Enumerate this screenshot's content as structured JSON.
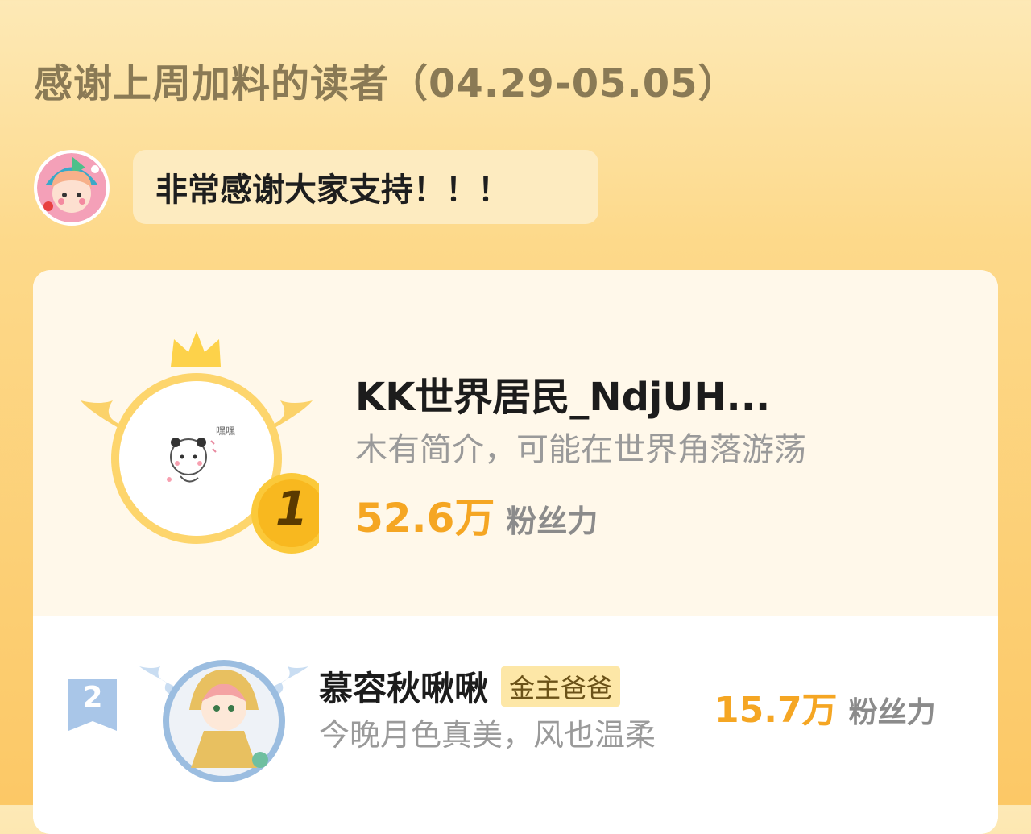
{
  "title": "感谢上周加料的读者（04.29-05.05）",
  "author_message": "非常感谢大家支持！！！",
  "ranking": [
    {
      "rank": "1",
      "name": "KK世界居民_NdjUH...",
      "bio": "木有简介，可能在世界角落游荡",
      "fans_value": "52.6万",
      "fans_label": "粉丝力",
      "avatar_text": "嘿嘿"
    },
    {
      "rank": "2",
      "name": "慕容秋啾啾",
      "badge": "金主爸爸",
      "bio": "今晚月色真美，风也温柔",
      "fans_value": "15.7万",
      "fans_label": "粉丝力"
    }
  ],
  "colors": {
    "accent": "#f5a623",
    "title": "#8a7a55",
    "badge_bg": "#fde7a7"
  }
}
